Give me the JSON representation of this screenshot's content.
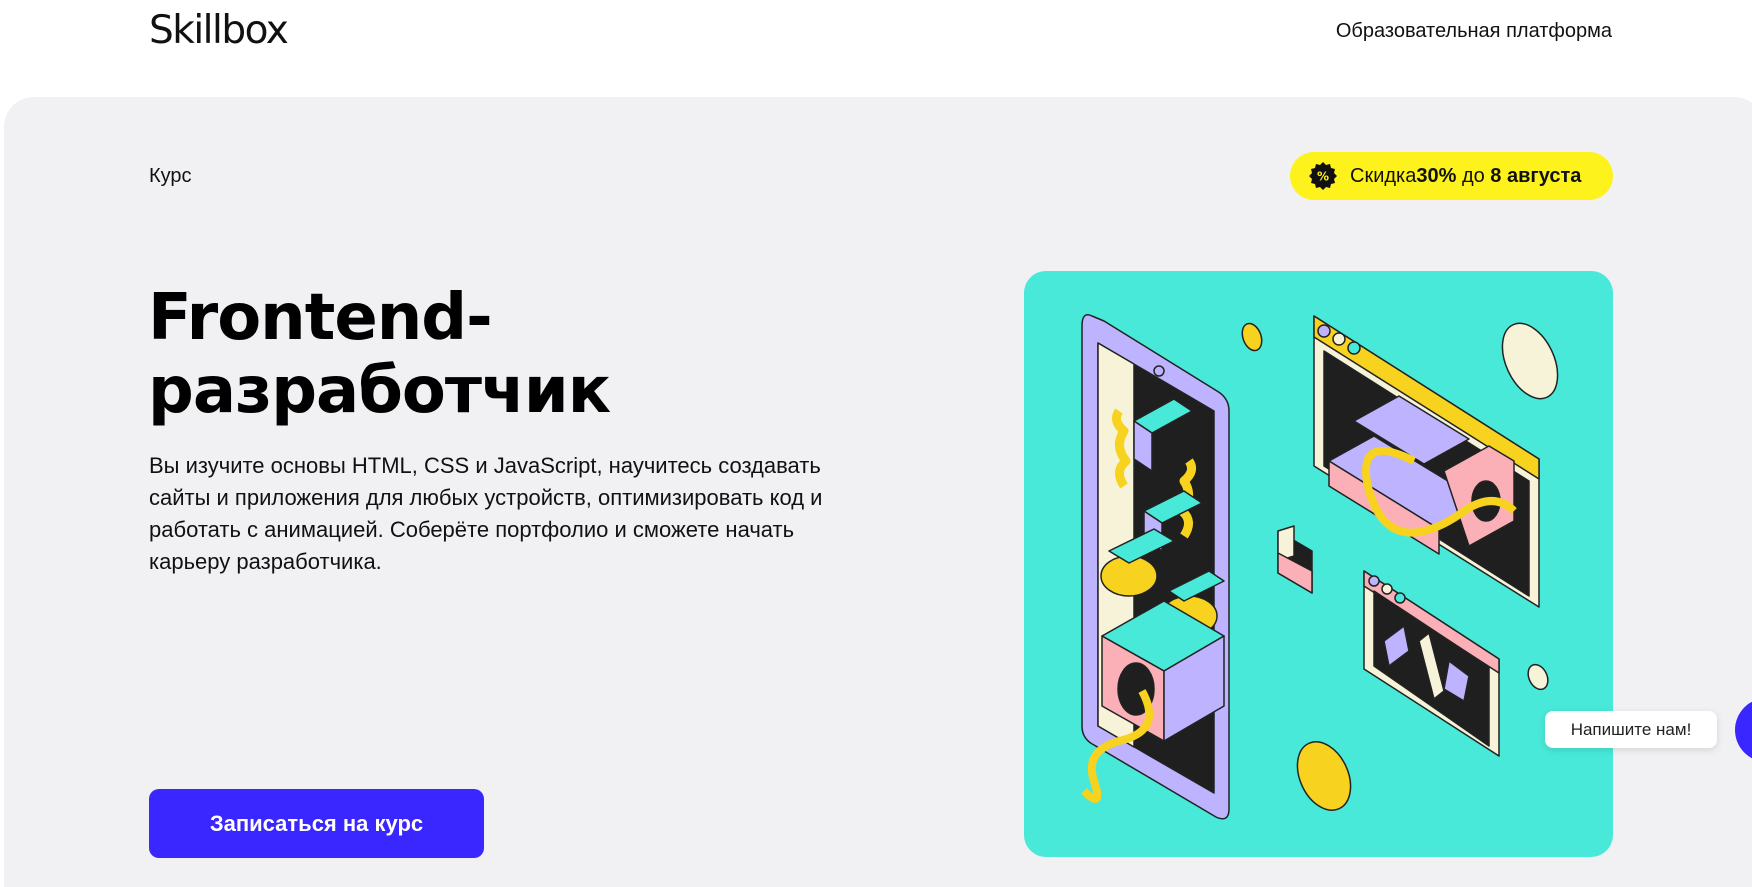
{
  "header": {
    "logo": "Skillbox",
    "platform_link": "Образовательная платформа"
  },
  "hero": {
    "kicker": "Курс",
    "promo": {
      "prefix": "Скидка ",
      "discount": "30%",
      "middle": " до ",
      "date": "8 августа",
      "icon": "percent-badge-icon"
    },
    "title_line1": "Frontend-",
    "title_line2": "разработчик",
    "description": "Вы изучите основы HTML, CSS и JavaScript, научитесь создавать сайты и приложения для любых устройств, оптимизировать код и работать с анимацией. Соберёте портфолио и сможете начать карьеру разработчика.",
    "cta_label": "Записаться на курс"
  },
  "chat": {
    "bubble_label": "Напишите нам!"
  },
  "colors": {
    "accent": "#3a27ff",
    "promo_bg": "#fdf21b",
    "hero_bg": "#f1f1f4",
    "illustration_bg": "#48e9d8"
  }
}
